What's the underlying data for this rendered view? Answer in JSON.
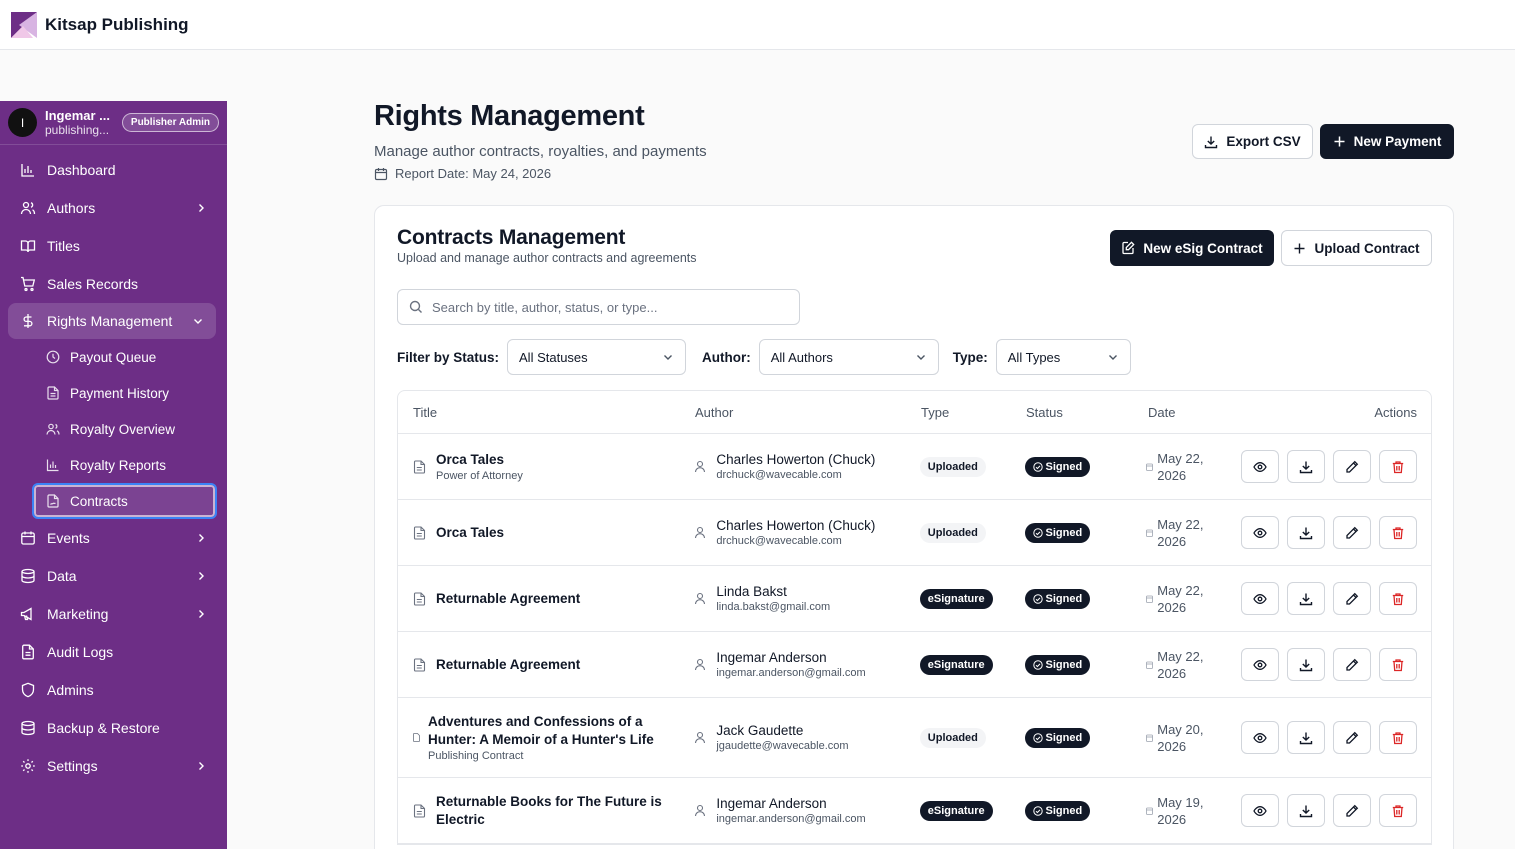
{
  "app": {
    "brand": "Kitsap Publishing"
  },
  "user": {
    "initial": "I",
    "name": "Ingemar ...",
    "email": "publishing...",
    "role": "Publisher Admin"
  },
  "nav": {
    "dashboard": "Dashboard",
    "authors": "Authors",
    "titles": "Titles",
    "sales": "Sales Records",
    "rights": "Rights Management",
    "sub": {
      "payout": "Payout Queue",
      "history": "Payment History",
      "royalty_overview": "Royalty Overview",
      "royalty_reports": "Royalty Reports",
      "contracts": "Contracts"
    },
    "events": "Events",
    "data": "Data",
    "marketing": "Marketing",
    "audit": "Audit Logs",
    "admins": "Admins",
    "backup": "Backup & Restore",
    "settings": "Settings"
  },
  "header": {
    "title": "Rights Management",
    "subtitle": "Manage author contracts, royalties, and payments",
    "report_date": "Report Date: May 24, 2026",
    "export_label": "Export CSV",
    "new_payment_label": "New Payment"
  },
  "contracts": {
    "title": "Contracts Management",
    "subtitle": "Upload and manage author contracts and agreements",
    "new_esig_label": "New eSig Contract",
    "upload_label": "Upload Contract",
    "search_placeholder": "Search by title, author, status, or type...",
    "filter_status_label": "Filter by Status:",
    "filter_status_value": "All Statuses",
    "author_label": "Author:",
    "author_value": "All Authors",
    "type_label": "Type:",
    "type_value": "All Types",
    "columns": {
      "title": "Title",
      "author": "Author",
      "type": "Type",
      "status": "Status",
      "date": "Date",
      "actions": "Actions"
    },
    "rows": [
      {
        "title": "Orca Tales",
        "subtitle": "Power of Attorney",
        "author": "Charles Howerton (Chuck)",
        "email": "drchuck@wavecable.com",
        "type": "Uploaded",
        "status": "Signed",
        "date_line1": "May 22,",
        "date_line2": "2026"
      },
      {
        "title": "Orca Tales",
        "subtitle": "",
        "author": "Charles Howerton (Chuck)",
        "email": "drchuck@wavecable.com",
        "type": "Uploaded",
        "status": "Signed",
        "date_line1": "May 22,",
        "date_line2": "2026"
      },
      {
        "title": "Returnable Agreement",
        "subtitle": "",
        "author": "Linda Bakst",
        "email": "linda.bakst@gmail.com",
        "type": "eSignature",
        "status": "Signed",
        "date_line1": "May 22,",
        "date_line2": "2026"
      },
      {
        "title": "Returnable Agreement",
        "subtitle": "",
        "author": "Ingemar Anderson",
        "email": "ingemar.anderson@gmail.com",
        "type": "eSignature",
        "status": "Signed",
        "date_line1": "May 22,",
        "date_line2": "2026"
      },
      {
        "title_line1": "Adventures and Confessions of a",
        "title_line2": "Hunter: A Memoir of a Hunter's Life",
        "subtitle": "Publishing Contract",
        "author": "Jack Gaudette",
        "email": "jgaudette@wavecable.com",
        "type": "Uploaded",
        "status": "Signed",
        "date_line1": "May 20,",
        "date_line2": "2026"
      },
      {
        "title_line1": "Returnable Books for The Future is",
        "title_line2": "Electric",
        "subtitle": "",
        "author": "Ingemar Anderson",
        "email": "ingemar.anderson@gmail.com",
        "type": "eSignature",
        "status": "Signed",
        "date_line1": "May 19,",
        "date_line2": "2026"
      }
    ]
  },
  "colors": {
    "sidebar": "#6d2e86",
    "primary": "#111827",
    "danger": "#dc2626"
  }
}
